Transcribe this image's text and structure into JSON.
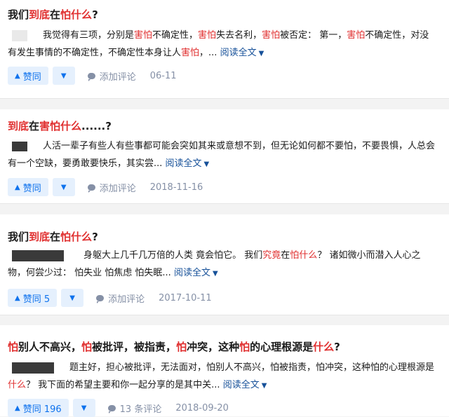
{
  "posts": [
    {
      "title_parts": [
        {
          "text": "我们",
          "hl": false
        },
        {
          "text": "到底",
          "hl": true
        },
        {
          "text": "在",
          "hl": false
        },
        {
          "text": "怕什么",
          "hl": true
        },
        {
          "text": "?",
          "hl": false
        }
      ],
      "excerpt_line1": [
        {
          "text": "我觉得有三项，分别是",
          "hl": false
        },
        {
          "text": "害怕",
          "hl": true
        },
        {
          "text": "不确定性，",
          "hl": false
        },
        {
          "text": "害怕",
          "hl": true
        },
        {
          "text": "失去名利，",
          "hl": false
        },
        {
          "text": "害怕",
          "hl": true
        },
        {
          "text": "被否定： 第一，",
          "hl": false
        },
        {
          "text": "害怕",
          "hl": true
        },
        {
          "text": "不确定性，对没",
          "hl": false
        }
      ],
      "excerpt_line2": [
        {
          "text": "有发生事情的不确定性，不确定性本身让人",
          "hl": false
        },
        {
          "text": "害怕",
          "hl": true
        },
        {
          "text": "，...",
          "hl": false
        }
      ],
      "read_more": "阅读全文",
      "vote_label": "赞同",
      "comment_label": "添加评论",
      "date": "06-11"
    },
    {
      "title_parts": [
        {
          "text": "到底",
          "hl": true
        },
        {
          "text": "在",
          "hl": false
        },
        {
          "text": "害怕什么",
          "hl": true
        },
        {
          "text": "......?",
          "hl": false
        }
      ],
      "excerpt_line1": [
        {
          "text": "人活一辈子有些人有些事都可能会突如其来或意想不到，但无论如何都不要怕，不要畏惧，人总会",
          "hl": false
        }
      ],
      "excerpt_line2": [
        {
          "text": "有一个空缺，要勇敢要快乐，其实尝... ",
          "hl": false
        }
      ],
      "read_more": "阅读全文",
      "vote_label": "赞同",
      "comment_label": "添加评论",
      "date": "2018-11-16"
    },
    {
      "title_parts": [
        {
          "text": "我们",
          "hl": false
        },
        {
          "text": "到底",
          "hl": true
        },
        {
          "text": "在",
          "hl": false
        },
        {
          "text": "怕什么",
          "hl": true
        },
        {
          "text": "?",
          "hl": false
        }
      ],
      "excerpt_line1": [
        {
          "text": "身躯大上几千几万倍的人类 竟会怕它。 我们",
          "hl": false
        },
        {
          "text": "究竟",
          "hl": true
        },
        {
          "text": "在",
          "hl": false
        },
        {
          "text": "怕什么",
          "hl": true
        },
        {
          "text": "？ 诸如微小而潜入人心之",
          "hl": false
        }
      ],
      "excerpt_line2": [
        {
          "text": "物，何尝少过： 怕失业 怕焦虑 怕失眠... ",
          "hl": false
        }
      ],
      "read_more": "阅读全文",
      "vote_label": "赞同 5",
      "comment_label": "添加评论",
      "date": "2017-10-11"
    },
    {
      "title_parts": [
        {
          "text": "怕",
          "hl": true
        },
        {
          "text": "别人不高兴，",
          "hl": false
        },
        {
          "text": "怕",
          "hl": true
        },
        {
          "text": "被批评，被指责，",
          "hl": false
        },
        {
          "text": "怕",
          "hl": true
        },
        {
          "text": "冲突，这种",
          "hl": false
        },
        {
          "text": "怕",
          "hl": true
        },
        {
          "text": "的心理根源是",
          "hl": false
        },
        {
          "text": "什么",
          "hl": true
        },
        {
          "text": "?",
          "hl": false
        }
      ],
      "excerpt_line1": [
        {
          "text": "题主好，担心被批评，无法面对，怕别人不高兴，怕被指责，怕冲突，这种怕的心理根源是",
          "hl": false
        }
      ],
      "excerpt_line2": [
        {
          "text": "什么",
          "hl": true
        },
        {
          "text": "？ 我下面的希望主要和你一起分享的是其中关... ",
          "hl": false
        }
      ],
      "read_more": "阅读全文",
      "vote_label": "赞同 196",
      "comment_label": "13 条评论",
      "date": "2018-09-20"
    }
  ],
  "icons": {
    "vote_up": "triangle-up-icon",
    "vote_down": "triangle-down-icon",
    "comment": "comment-bubble-icon",
    "read_more": "chevron-down-icon"
  },
  "colors": {
    "highlight": "#e02f2f",
    "link": "#175199",
    "vote_bg": "#e5f0fd",
    "vote_fg": "#0e72ed",
    "meta": "#8590a6"
  }
}
